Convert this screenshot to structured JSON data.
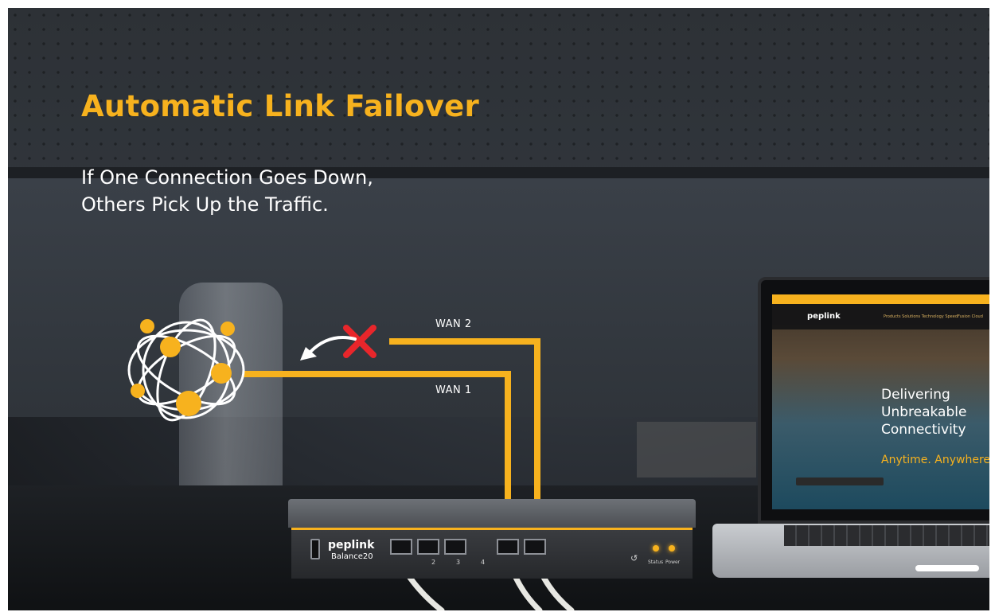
{
  "headline": "Automatic Link Failover",
  "subline": {
    "line1": "If One Connection Goes Down,",
    "line2": "Others Pick Up the Traffic."
  },
  "links": {
    "wan2_label": "WAN 2",
    "wan1_label": "WAN 1"
  },
  "router": {
    "brand": "peplink",
    "model": "Balance20",
    "ports": [
      "2",
      "3",
      "4"
    ],
    "status_label": "Status",
    "power_label": "Power"
  },
  "laptop": {
    "site_logo": "peplink",
    "nav_links": "Products    Solutions    Technology    SpeedFusion Cloud",
    "heading": {
      "line1": "Delivering",
      "line2": "Unbreakable",
      "line3": "Connectivity"
    },
    "tagline": "Anytime. Anywhere."
  },
  "icons": {
    "globe": "network-globe-icon",
    "failed": "x-mark-icon",
    "reroute": "curved-arrow-icon"
  },
  "colors": {
    "accent": "#f7b21e",
    "failure": "#e8262b",
    "text": "#ffffff"
  }
}
